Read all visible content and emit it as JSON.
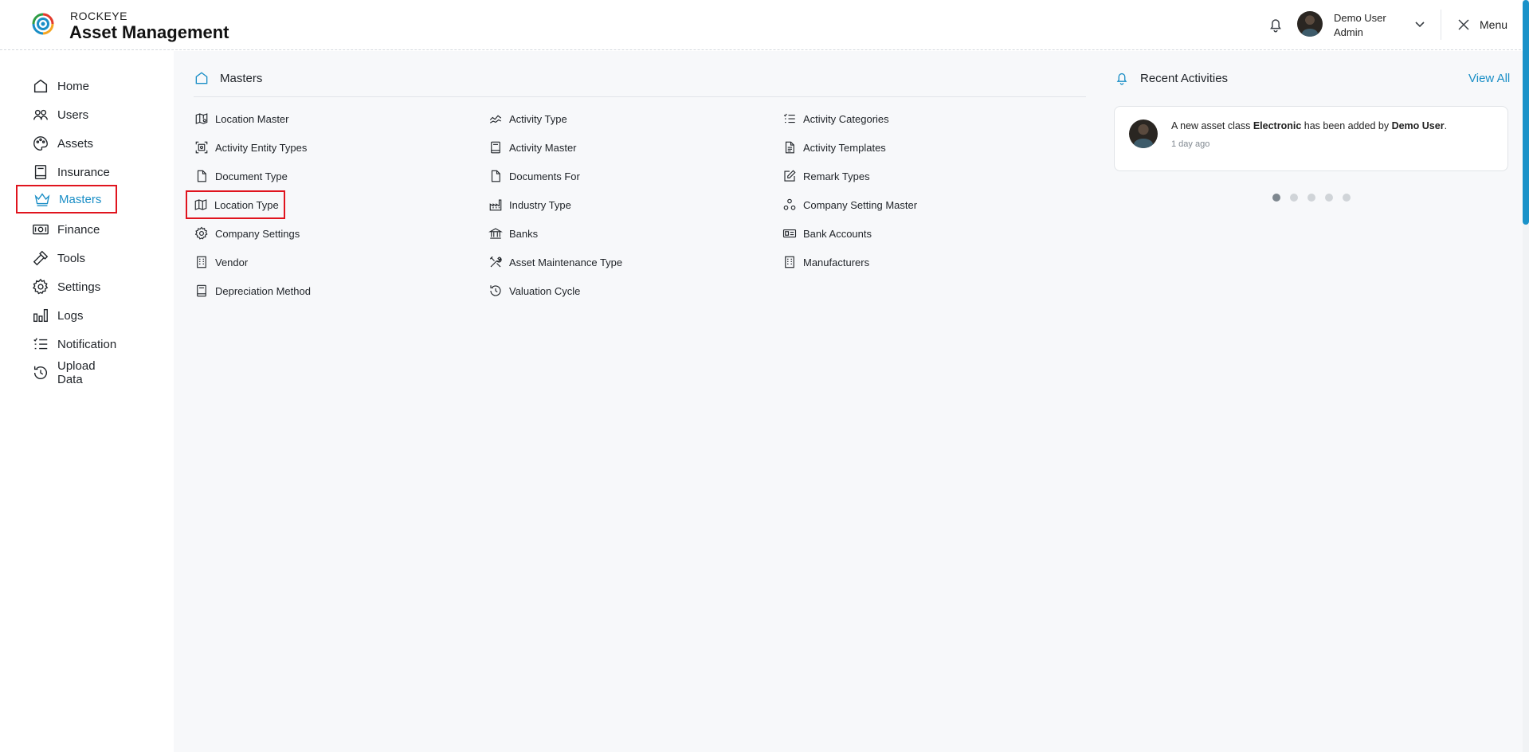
{
  "header": {
    "brand_small": "ROCKEYE",
    "brand_title": "Asset Management",
    "user_name": "Demo User",
    "user_role": "Admin",
    "menu_label": "Menu"
  },
  "sidebar": {
    "items": [
      {
        "label": "Home",
        "icon": "home-icon"
      },
      {
        "label": "Users",
        "icon": "users-icon"
      },
      {
        "label": "Assets",
        "icon": "palette-icon"
      },
      {
        "label": "Insurance",
        "icon": "book-icon"
      },
      {
        "label": "Masters",
        "icon": "crown-icon",
        "active": true
      },
      {
        "label": "Finance",
        "icon": "banknote-icon"
      },
      {
        "label": "Tools",
        "icon": "hammer-icon"
      },
      {
        "label": "Settings",
        "icon": "gear-icon"
      },
      {
        "label": "Logs",
        "icon": "bar-chart-icon"
      },
      {
        "label": "Notification",
        "icon": "list-check-icon"
      },
      {
        "label": "Upload Data",
        "icon": "history-icon"
      }
    ]
  },
  "masters": {
    "title": "Masters",
    "col1": [
      {
        "label": "Location Master",
        "icon": "map-pin-icon"
      },
      {
        "label": "Activity Entity Types",
        "icon": "scan-icon"
      },
      {
        "label": "Document Type",
        "icon": "file-icon"
      },
      {
        "label": "Location Type",
        "icon": "map-icon"
      },
      {
        "label": "Company Settings",
        "icon": "gear-icon"
      },
      {
        "label": "Vendor",
        "icon": "building-icon"
      },
      {
        "label": "Depreciation Method",
        "icon": "book-icon"
      }
    ],
    "col2": [
      {
        "label": "Activity Type",
        "icon": "activity-icon"
      },
      {
        "label": "Activity Master",
        "icon": "book-icon"
      },
      {
        "label": "Documents For",
        "icon": "file-icon"
      },
      {
        "label": "Industry Type",
        "icon": "factory-icon"
      },
      {
        "label": "Banks",
        "icon": "bank-icon"
      },
      {
        "label": "Asset Maintenance Type",
        "icon": "tools-icon"
      },
      {
        "label": "Valuation Cycle",
        "icon": "history-icon"
      }
    ],
    "col3": [
      {
        "label": "Activity Categories",
        "icon": "list-check-icon"
      },
      {
        "label": "Activity Templates",
        "icon": "file-text-icon"
      },
      {
        "label": "Remark Types",
        "icon": "edit-icon"
      },
      {
        "label": "Company Setting Master",
        "icon": "shapes-icon"
      },
      {
        "label": "Bank Accounts",
        "icon": "card-icon"
      },
      {
        "label": "Manufacturers",
        "icon": "building-icon"
      }
    ]
  },
  "recent": {
    "title": "Recent Activities",
    "view_all": "View All",
    "activity": {
      "prefix": "A new asset class ",
      "asset": "Electronic",
      "middle": " has been added by ",
      "user": "Demo User",
      "suffix": ".",
      "time": "1 day ago"
    },
    "pages": 5,
    "active_page": 1
  },
  "colors": {
    "accent": "#1a8ec6",
    "highlight_border": "#e0141e"
  }
}
